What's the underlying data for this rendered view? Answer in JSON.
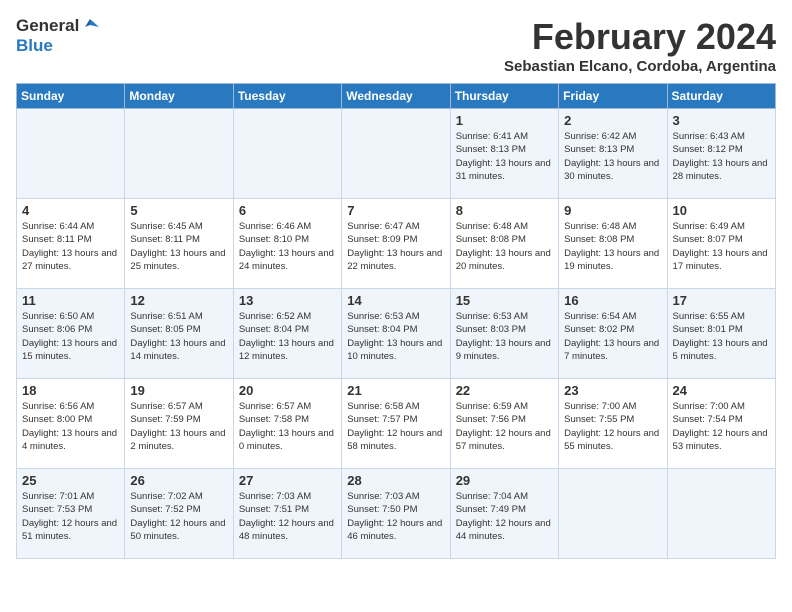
{
  "header": {
    "title": "February 2024",
    "location": "Sebastian Elcano, Cordoba, Argentina",
    "logo_general": "General",
    "logo_blue": "Blue"
  },
  "days_of_week": [
    "Sunday",
    "Monday",
    "Tuesday",
    "Wednesday",
    "Thursday",
    "Friday",
    "Saturday"
  ],
  "weeks": [
    [
      {
        "day": "",
        "info": ""
      },
      {
        "day": "",
        "info": ""
      },
      {
        "day": "",
        "info": ""
      },
      {
        "day": "",
        "info": ""
      },
      {
        "day": "1",
        "info": "Sunrise: 6:41 AM\nSunset: 8:13 PM\nDaylight: 13 hours\nand 31 minutes."
      },
      {
        "day": "2",
        "info": "Sunrise: 6:42 AM\nSunset: 8:13 PM\nDaylight: 13 hours\nand 30 minutes."
      },
      {
        "day": "3",
        "info": "Sunrise: 6:43 AM\nSunset: 8:12 PM\nDaylight: 13 hours\nand 28 minutes."
      }
    ],
    [
      {
        "day": "4",
        "info": "Sunrise: 6:44 AM\nSunset: 8:11 PM\nDaylight: 13 hours\nand 27 minutes."
      },
      {
        "day": "5",
        "info": "Sunrise: 6:45 AM\nSunset: 8:11 PM\nDaylight: 13 hours\nand 25 minutes."
      },
      {
        "day": "6",
        "info": "Sunrise: 6:46 AM\nSunset: 8:10 PM\nDaylight: 13 hours\nand 24 minutes."
      },
      {
        "day": "7",
        "info": "Sunrise: 6:47 AM\nSunset: 8:09 PM\nDaylight: 13 hours\nand 22 minutes."
      },
      {
        "day": "8",
        "info": "Sunrise: 6:48 AM\nSunset: 8:08 PM\nDaylight: 13 hours\nand 20 minutes."
      },
      {
        "day": "9",
        "info": "Sunrise: 6:48 AM\nSunset: 8:08 PM\nDaylight: 13 hours\nand 19 minutes."
      },
      {
        "day": "10",
        "info": "Sunrise: 6:49 AM\nSunset: 8:07 PM\nDaylight: 13 hours\nand 17 minutes."
      }
    ],
    [
      {
        "day": "11",
        "info": "Sunrise: 6:50 AM\nSunset: 8:06 PM\nDaylight: 13 hours\nand 15 minutes."
      },
      {
        "day": "12",
        "info": "Sunrise: 6:51 AM\nSunset: 8:05 PM\nDaylight: 13 hours\nand 14 minutes."
      },
      {
        "day": "13",
        "info": "Sunrise: 6:52 AM\nSunset: 8:04 PM\nDaylight: 13 hours\nand 12 minutes."
      },
      {
        "day": "14",
        "info": "Sunrise: 6:53 AM\nSunset: 8:04 PM\nDaylight: 13 hours\nand 10 minutes."
      },
      {
        "day": "15",
        "info": "Sunrise: 6:53 AM\nSunset: 8:03 PM\nDaylight: 13 hours\nand 9 minutes."
      },
      {
        "day": "16",
        "info": "Sunrise: 6:54 AM\nSunset: 8:02 PM\nDaylight: 13 hours\nand 7 minutes."
      },
      {
        "day": "17",
        "info": "Sunrise: 6:55 AM\nSunset: 8:01 PM\nDaylight: 13 hours\nand 5 minutes."
      }
    ],
    [
      {
        "day": "18",
        "info": "Sunrise: 6:56 AM\nSunset: 8:00 PM\nDaylight: 13 hours\nand 4 minutes."
      },
      {
        "day": "19",
        "info": "Sunrise: 6:57 AM\nSunset: 7:59 PM\nDaylight: 13 hours\nand 2 minutes."
      },
      {
        "day": "20",
        "info": "Sunrise: 6:57 AM\nSunset: 7:58 PM\nDaylight: 13 hours\nand 0 minutes."
      },
      {
        "day": "21",
        "info": "Sunrise: 6:58 AM\nSunset: 7:57 PM\nDaylight: 12 hours\nand 58 minutes."
      },
      {
        "day": "22",
        "info": "Sunrise: 6:59 AM\nSunset: 7:56 PM\nDaylight: 12 hours\nand 57 minutes."
      },
      {
        "day": "23",
        "info": "Sunrise: 7:00 AM\nSunset: 7:55 PM\nDaylight: 12 hours\nand 55 minutes."
      },
      {
        "day": "24",
        "info": "Sunrise: 7:00 AM\nSunset: 7:54 PM\nDaylight: 12 hours\nand 53 minutes."
      }
    ],
    [
      {
        "day": "25",
        "info": "Sunrise: 7:01 AM\nSunset: 7:53 PM\nDaylight: 12 hours\nand 51 minutes."
      },
      {
        "day": "26",
        "info": "Sunrise: 7:02 AM\nSunset: 7:52 PM\nDaylight: 12 hours\nand 50 minutes."
      },
      {
        "day": "27",
        "info": "Sunrise: 7:03 AM\nSunset: 7:51 PM\nDaylight: 12 hours\nand 48 minutes."
      },
      {
        "day": "28",
        "info": "Sunrise: 7:03 AM\nSunset: 7:50 PM\nDaylight: 12 hours\nand 46 minutes."
      },
      {
        "day": "29",
        "info": "Sunrise: 7:04 AM\nSunset: 7:49 PM\nDaylight: 12 hours\nand 44 minutes."
      },
      {
        "day": "",
        "info": ""
      },
      {
        "day": "",
        "info": ""
      }
    ]
  ]
}
